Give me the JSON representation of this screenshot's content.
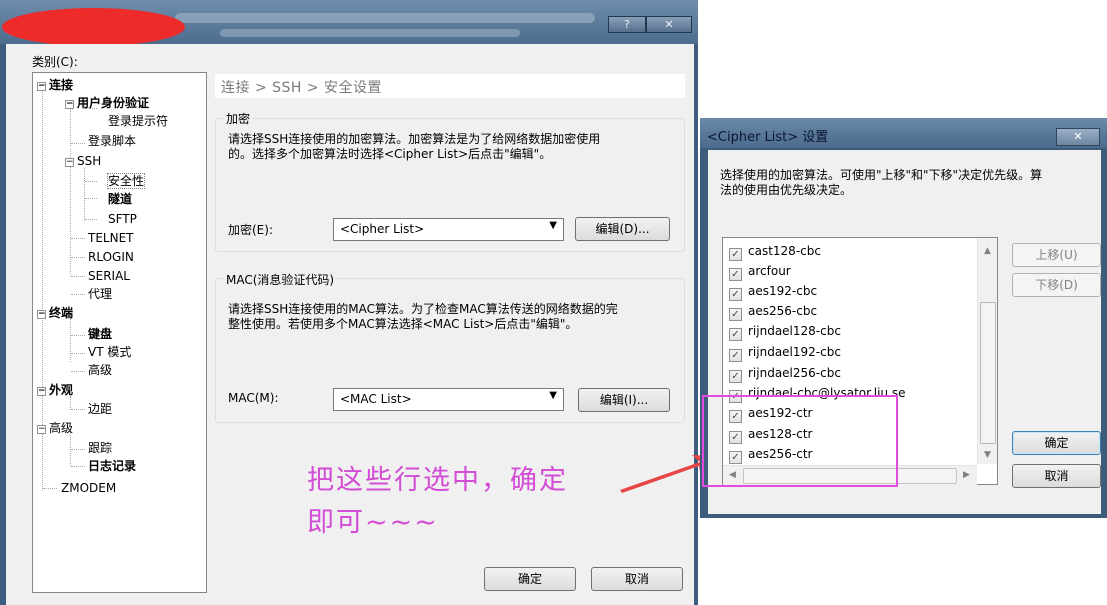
{
  "main_window": {
    "titlebar_buttons": {
      "help": "?",
      "close": "✕"
    },
    "category_label": "类别(C):",
    "tree": {
      "connection": "连接",
      "auth": "用户身份验证",
      "login_prompt": "登录提示符",
      "login_script": "登录脚本",
      "ssh": "SSH",
      "security": "安全性",
      "tunnel": "隧道",
      "sftp": "SFTP",
      "telnet": "TELNET",
      "rlogin": "RLOGIN",
      "serial": "SERIAL",
      "proxy": "代理",
      "terminal": "终端",
      "keyboard": "键盘",
      "vt_mode": "VT 模式",
      "term_advanced": "高级",
      "appearance": "外观",
      "margin": "边距",
      "advanced": "高级",
      "trace": "跟踪",
      "log": "日志记录",
      "zmodem": "ZMODEM",
      "collapse": "−"
    },
    "breadcrumb": "连接 > SSH > 安全设置",
    "encryption": {
      "group_title": "加密",
      "desc_line1": "请选择SSH连接使用的加密算法。加密算法是为了给网络数据加密使用",
      "desc_line2": "的。选择多个加密算法时选择<Cipher List>后点击\"编辑\"。",
      "label": "加密(E):",
      "value": "<Cipher List>",
      "edit_button": "编辑(D)..."
    },
    "mac": {
      "group_title": "MAC(消息验证代码)",
      "desc_line1": "请选择SSH连接使用的MAC算法。为了检查MAC算法传送的网络数据的完",
      "desc_line2": "整性使用。若使用多个MAC算法选择<MAC List>后点击\"编辑\"。",
      "label": "MAC(M):",
      "value": "<MAC List>",
      "edit_button": "编辑(I)..."
    },
    "ok_button": "确定",
    "cancel_button": "取消"
  },
  "annotation": {
    "line1": "把这些行选中，确定",
    "line2": "即可~~~"
  },
  "cipher_dialog": {
    "title": "<Cipher List> 设置",
    "close": "✕",
    "desc_line1": "选择使用的加密算法。可使用\"上移\"和\"下移\"决定优先级。算",
    "desc_line2": "法的使用由优先级决定。",
    "check_glyph": "✓",
    "items": [
      {
        "label": "cast128-cbc"
      },
      {
        "label": "arcfour"
      },
      {
        "label": "aes192-cbc"
      },
      {
        "label": "aes256-cbc"
      },
      {
        "label": "rijndael128-cbc"
      },
      {
        "label": "rijndael192-cbc"
      },
      {
        "label": "rijndael256-cbc"
      },
      {
        "label": "rijndael-cbc@lysator.liu.se"
      },
      {
        "label": "aes192-ctr"
      },
      {
        "label": "aes128-ctr"
      },
      {
        "label": "aes256-ctr"
      }
    ],
    "move_up": "上移(U)",
    "move_down": "下移(D)",
    "ok_button": "确定",
    "cancel_button": "取消",
    "scroll_glyphs": {
      "up": "▲",
      "down": "▼",
      "left": "◀",
      "right": "▶",
      "combo": "▼"
    }
  },
  "colors": {
    "highlight": "#e24be0",
    "annotation": "#d24cd6",
    "red_mark": "#ee2b2b"
  }
}
